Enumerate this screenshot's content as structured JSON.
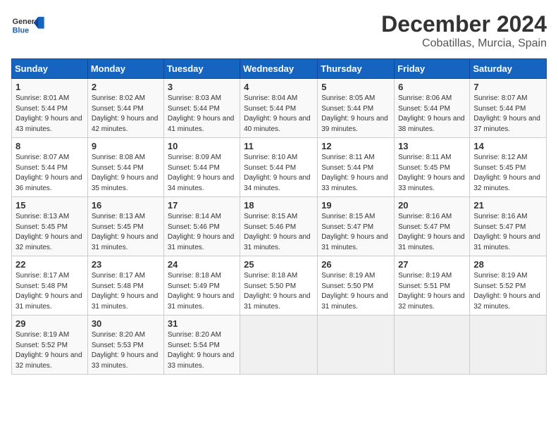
{
  "header": {
    "logo_general": "General",
    "logo_blue": "Blue",
    "title": "December 2024",
    "subtitle": "Cobatillas, Murcia, Spain"
  },
  "weekdays": [
    "Sunday",
    "Monday",
    "Tuesday",
    "Wednesday",
    "Thursday",
    "Friday",
    "Saturday"
  ],
  "weeks": [
    [
      {
        "day": 1,
        "sunrise": "8:01 AM",
        "sunset": "5:44 PM",
        "daylight": "9 hours and 43 minutes."
      },
      {
        "day": 2,
        "sunrise": "8:02 AM",
        "sunset": "5:44 PM",
        "daylight": "9 hours and 42 minutes."
      },
      {
        "day": 3,
        "sunrise": "8:03 AM",
        "sunset": "5:44 PM",
        "daylight": "9 hours and 41 minutes."
      },
      {
        "day": 4,
        "sunrise": "8:04 AM",
        "sunset": "5:44 PM",
        "daylight": "9 hours and 40 minutes."
      },
      {
        "day": 5,
        "sunrise": "8:05 AM",
        "sunset": "5:44 PM",
        "daylight": "9 hours and 39 minutes."
      },
      {
        "day": 6,
        "sunrise": "8:06 AM",
        "sunset": "5:44 PM",
        "daylight": "9 hours and 38 minutes."
      },
      {
        "day": 7,
        "sunrise": "8:07 AM",
        "sunset": "5:44 PM",
        "daylight": "9 hours and 37 minutes."
      }
    ],
    [
      {
        "day": 8,
        "sunrise": "8:07 AM",
        "sunset": "5:44 PM",
        "daylight": "9 hours and 36 minutes."
      },
      {
        "day": 9,
        "sunrise": "8:08 AM",
        "sunset": "5:44 PM",
        "daylight": "9 hours and 35 minutes."
      },
      {
        "day": 10,
        "sunrise": "8:09 AM",
        "sunset": "5:44 PM",
        "daylight": "9 hours and 34 minutes."
      },
      {
        "day": 11,
        "sunrise": "8:10 AM",
        "sunset": "5:44 PM",
        "daylight": "9 hours and 34 minutes."
      },
      {
        "day": 12,
        "sunrise": "8:11 AM",
        "sunset": "5:44 PM",
        "daylight": "9 hours and 33 minutes."
      },
      {
        "day": 13,
        "sunrise": "8:11 AM",
        "sunset": "5:45 PM",
        "daylight": "9 hours and 33 minutes."
      },
      {
        "day": 14,
        "sunrise": "8:12 AM",
        "sunset": "5:45 PM",
        "daylight": "9 hours and 32 minutes."
      }
    ],
    [
      {
        "day": 15,
        "sunrise": "8:13 AM",
        "sunset": "5:45 PM",
        "daylight": "9 hours and 32 minutes."
      },
      {
        "day": 16,
        "sunrise": "8:13 AM",
        "sunset": "5:45 PM",
        "daylight": "9 hours and 31 minutes."
      },
      {
        "day": 17,
        "sunrise": "8:14 AM",
        "sunset": "5:46 PM",
        "daylight": "9 hours and 31 minutes."
      },
      {
        "day": 18,
        "sunrise": "8:15 AM",
        "sunset": "5:46 PM",
        "daylight": "9 hours and 31 minutes."
      },
      {
        "day": 19,
        "sunrise": "8:15 AM",
        "sunset": "5:47 PM",
        "daylight": "9 hours and 31 minutes."
      },
      {
        "day": 20,
        "sunrise": "8:16 AM",
        "sunset": "5:47 PM",
        "daylight": "9 hours and 31 minutes."
      },
      {
        "day": 21,
        "sunrise": "8:16 AM",
        "sunset": "5:47 PM",
        "daylight": "9 hours and 31 minutes."
      }
    ],
    [
      {
        "day": 22,
        "sunrise": "8:17 AM",
        "sunset": "5:48 PM",
        "daylight": "9 hours and 31 minutes."
      },
      {
        "day": 23,
        "sunrise": "8:17 AM",
        "sunset": "5:48 PM",
        "daylight": "9 hours and 31 minutes."
      },
      {
        "day": 24,
        "sunrise": "8:18 AM",
        "sunset": "5:49 PM",
        "daylight": "9 hours and 31 minutes."
      },
      {
        "day": 25,
        "sunrise": "8:18 AM",
        "sunset": "5:50 PM",
        "daylight": "9 hours and 31 minutes."
      },
      {
        "day": 26,
        "sunrise": "8:19 AM",
        "sunset": "5:50 PM",
        "daylight": "9 hours and 31 minutes."
      },
      {
        "day": 27,
        "sunrise": "8:19 AM",
        "sunset": "5:51 PM",
        "daylight": "9 hours and 32 minutes."
      },
      {
        "day": 28,
        "sunrise": "8:19 AM",
        "sunset": "5:52 PM",
        "daylight": "9 hours and 32 minutes."
      }
    ],
    [
      {
        "day": 29,
        "sunrise": "8:19 AM",
        "sunset": "5:52 PM",
        "daylight": "9 hours and 32 minutes."
      },
      {
        "day": 30,
        "sunrise": "8:20 AM",
        "sunset": "5:53 PM",
        "daylight": "9 hours and 33 minutes."
      },
      {
        "day": 31,
        "sunrise": "8:20 AM",
        "sunset": "5:54 PM",
        "daylight": "9 hours and 33 minutes."
      },
      null,
      null,
      null,
      null
    ]
  ]
}
